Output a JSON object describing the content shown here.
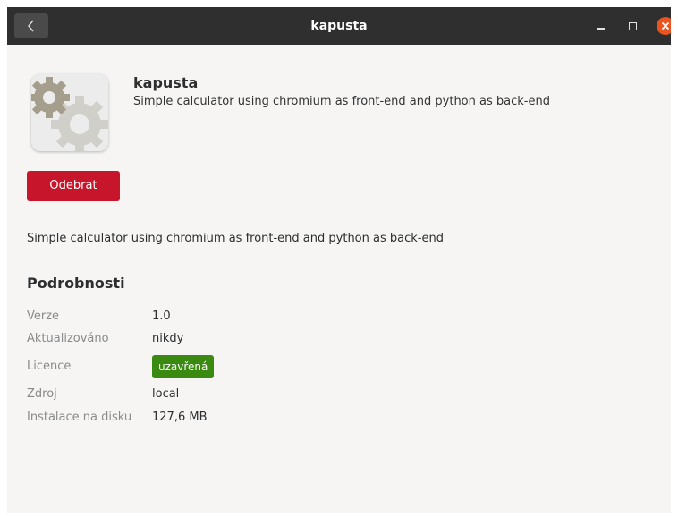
{
  "window": {
    "title": "kapusta"
  },
  "app": {
    "name": "kapusta",
    "summary": "Simple calculator using chromium as front-end and python as back-end",
    "icon": "gears-icon",
    "remove_label": "Odebrat",
    "description": "Simple calculator using chromium as front-end and python as back-end"
  },
  "details": {
    "title": "Podrobnosti",
    "version_label": "Verze",
    "version_value": "1.0",
    "updated_label": "Aktualizováno",
    "updated_value": "nikdy",
    "license_label": "Licence",
    "license_value": "uzavřená",
    "source_label": "Zdroj",
    "source_value": "local",
    "installed_label": "Instalace na disku",
    "installed_value": "127,6 MB"
  },
  "colors": {
    "titlebar": "#2f2f2f",
    "remove_button": "#c7162b",
    "license_badge": "#3a8a12",
    "close_button": "#e95420"
  }
}
